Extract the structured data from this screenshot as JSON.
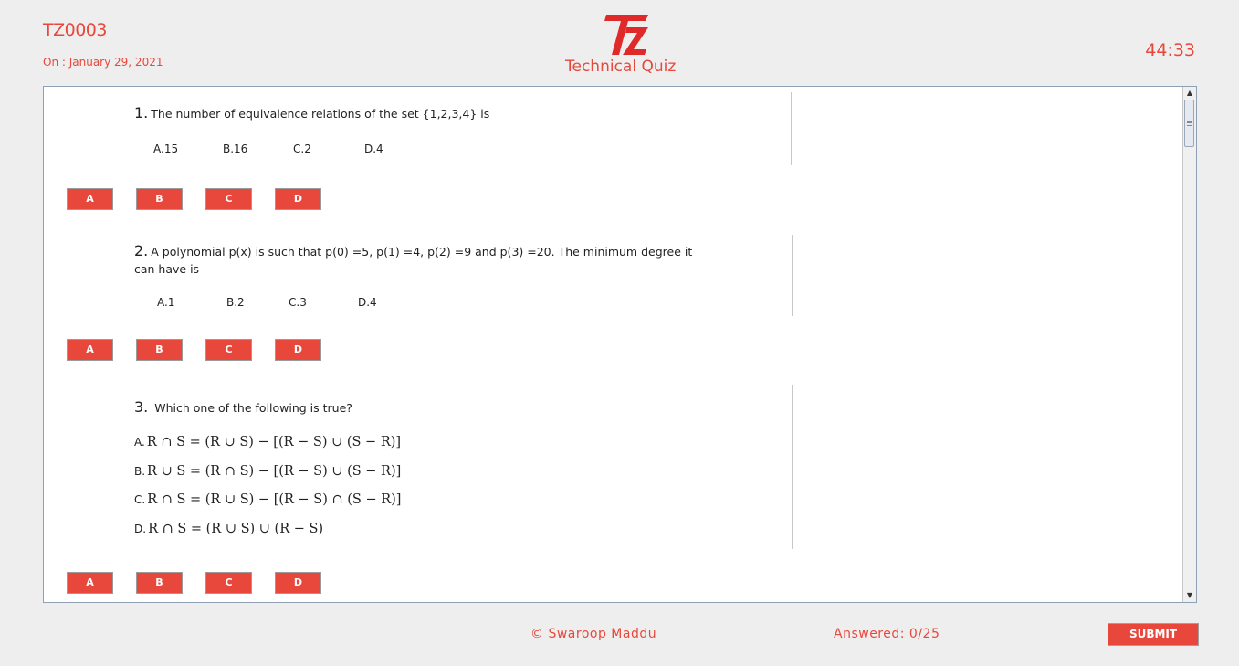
{
  "header": {
    "quiz_code": "TZ0003",
    "date_label": "On : January 29, 2021",
    "app_title": "Technical Quiz",
    "timer": "44:33",
    "logo_text": "TZ"
  },
  "colors": {
    "accent": "#e8483c",
    "panel_border": "#8da0b4"
  },
  "questions": [
    {
      "number": "1.",
      "text": "The number of equivalence relations of the set {1,2,3,4} is",
      "options": [
        "A.15",
        "B.16",
        "C.2",
        "D.4"
      ],
      "buttons": [
        "A",
        "B",
        "C",
        "D"
      ]
    },
    {
      "number": "2.",
      "text": "A polynomial p(x) is such that p(0) =5, p(1) =4, p(2) =9 and p(3) =20. The minimum degree it can have is",
      "options": [
        "A.1",
        "B.2",
        "C.3",
        "D.4"
      ],
      "buttons": [
        "A",
        "B",
        "C",
        "D"
      ]
    },
    {
      "number": "3.",
      "text": "Which one of the following is true?",
      "options": [
        {
          "letter": "A.",
          "expr": "R ∩ S = (R ∪ S) − [(R − S) ∪ (S − R)]"
        },
        {
          "letter": "B.",
          "expr": "R ∪ S = (R ∩ S) − [(R − S) ∪ (S − R)]"
        },
        {
          "letter": "C.",
          "expr": "R ∩ S = (R ∪ S) − [(R − S) ∩ (S − R)]"
        },
        {
          "letter": "D.",
          "expr": "R ∩ S = (R ∪ S) ∪ (R − S)"
        }
      ],
      "buttons": [
        "A",
        "B",
        "C",
        "D"
      ]
    }
  ],
  "icons": {
    "scroll_up": "triangle-up-icon",
    "scroll_down": "triangle-down-icon"
  },
  "footer": {
    "copyright": "© Swaroop Maddu",
    "answered": "Answered: 0/25",
    "submit_label": "SUBMIT"
  }
}
